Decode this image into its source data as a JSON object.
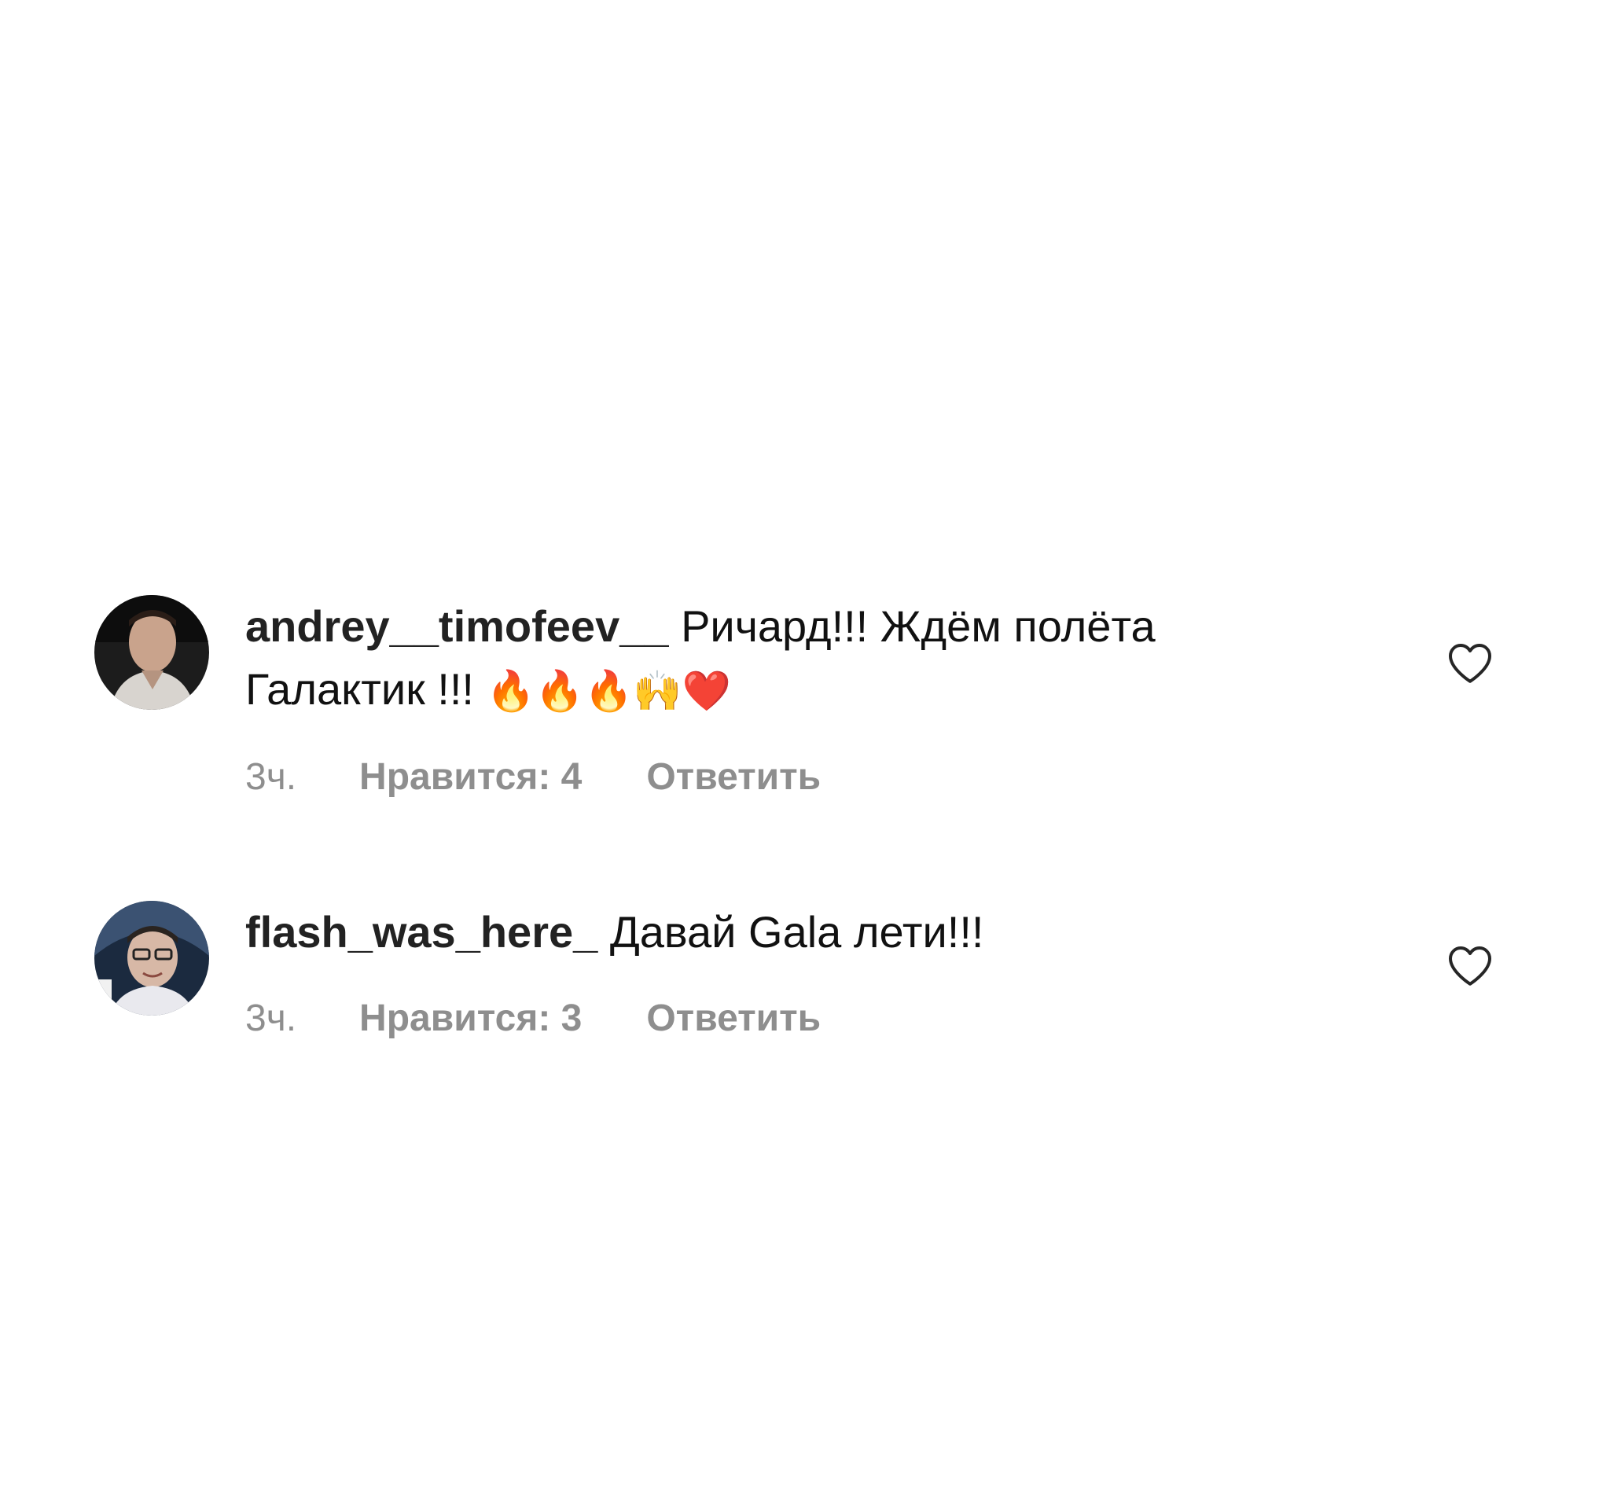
{
  "comments": [
    {
      "username": "andrey__timofeev__",
      "text_line1": "Ричард!!! Ждём полёта",
      "text_line2": "Галактик !!!",
      "emojis": "🔥🔥🔥🙌❤️",
      "time": "3ч.",
      "likes": "Нравится: 4",
      "reply": "Ответить",
      "avatar_icon": "user-photo-avatar",
      "like_icon": "heart-outline-icon"
    },
    {
      "username": "flash_was_here_",
      "text_line1": "Давай Gala лети!!!",
      "time": "3ч.",
      "likes": "Нравится: 3",
      "reply": "Ответить",
      "avatar_icon": "user-photo-avatar",
      "like_icon": "heart-outline-icon"
    }
  ],
  "colors": {
    "background": "#ffffff",
    "text": "#111111",
    "meta": "#8e8e8e",
    "heart_stroke": "#262626"
  }
}
